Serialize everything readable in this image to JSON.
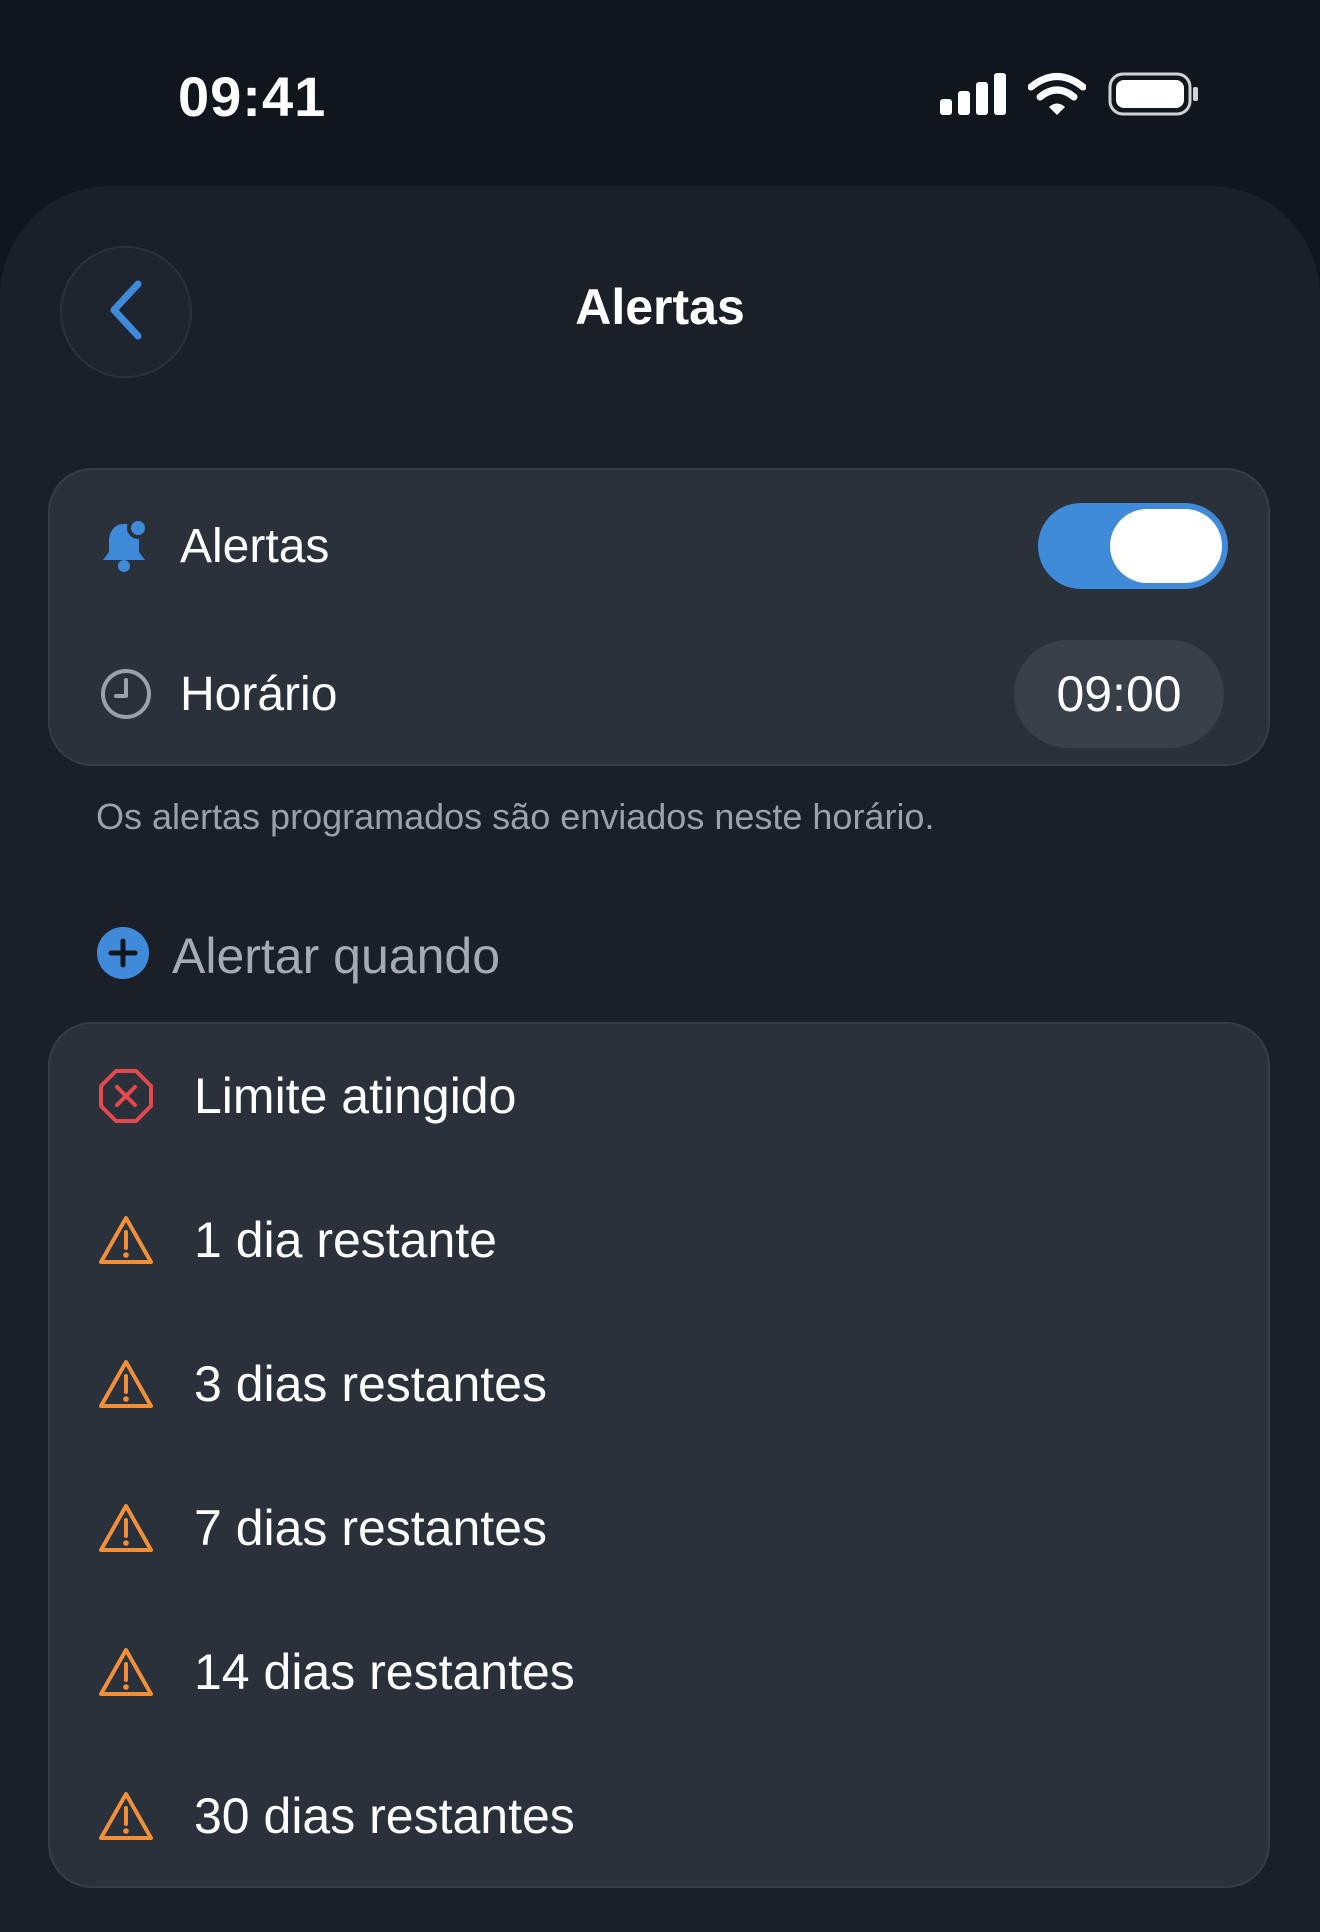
{
  "status_bar": {
    "time": "09:41",
    "icons": [
      "cellular-signal-icon",
      "wifi-icon",
      "battery-icon"
    ]
  },
  "header": {
    "back_icon": "chevron-left-icon",
    "title": "Alertas"
  },
  "settings": {
    "alerts": {
      "icon": "bell-badge-icon",
      "label": "Alertas",
      "enabled": true
    },
    "schedule": {
      "icon": "clock-icon",
      "label": "Horário",
      "value": "09:00"
    },
    "footnote": "Os alertas programados são enviados neste horário."
  },
  "alert_when": {
    "icon": "plus-circle-icon",
    "label": "Alertar quando",
    "items": [
      {
        "icon": "x-octagon-icon",
        "label": "Limite atingido",
        "color": "#e5484d"
      },
      {
        "icon": "warning-triangle-icon",
        "label": "1 dia restante",
        "color": "#f0903a"
      },
      {
        "icon": "warning-triangle-icon",
        "label": "3 dias restantes",
        "color": "#f0903a"
      },
      {
        "icon": "warning-triangle-icon",
        "label": "7 dias restantes",
        "color": "#f0903a"
      },
      {
        "icon": "warning-triangle-icon",
        "label": "14 dias restantes",
        "color": "#f0903a"
      },
      {
        "icon": "warning-triangle-icon",
        "label": "30 dias restantes",
        "color": "#f0903a"
      }
    ]
  },
  "colors": {
    "accent": "#3f8ad9",
    "danger": "#e5484d",
    "warning": "#f0903a",
    "background": "#1b2028",
    "card": "#2b313a"
  }
}
